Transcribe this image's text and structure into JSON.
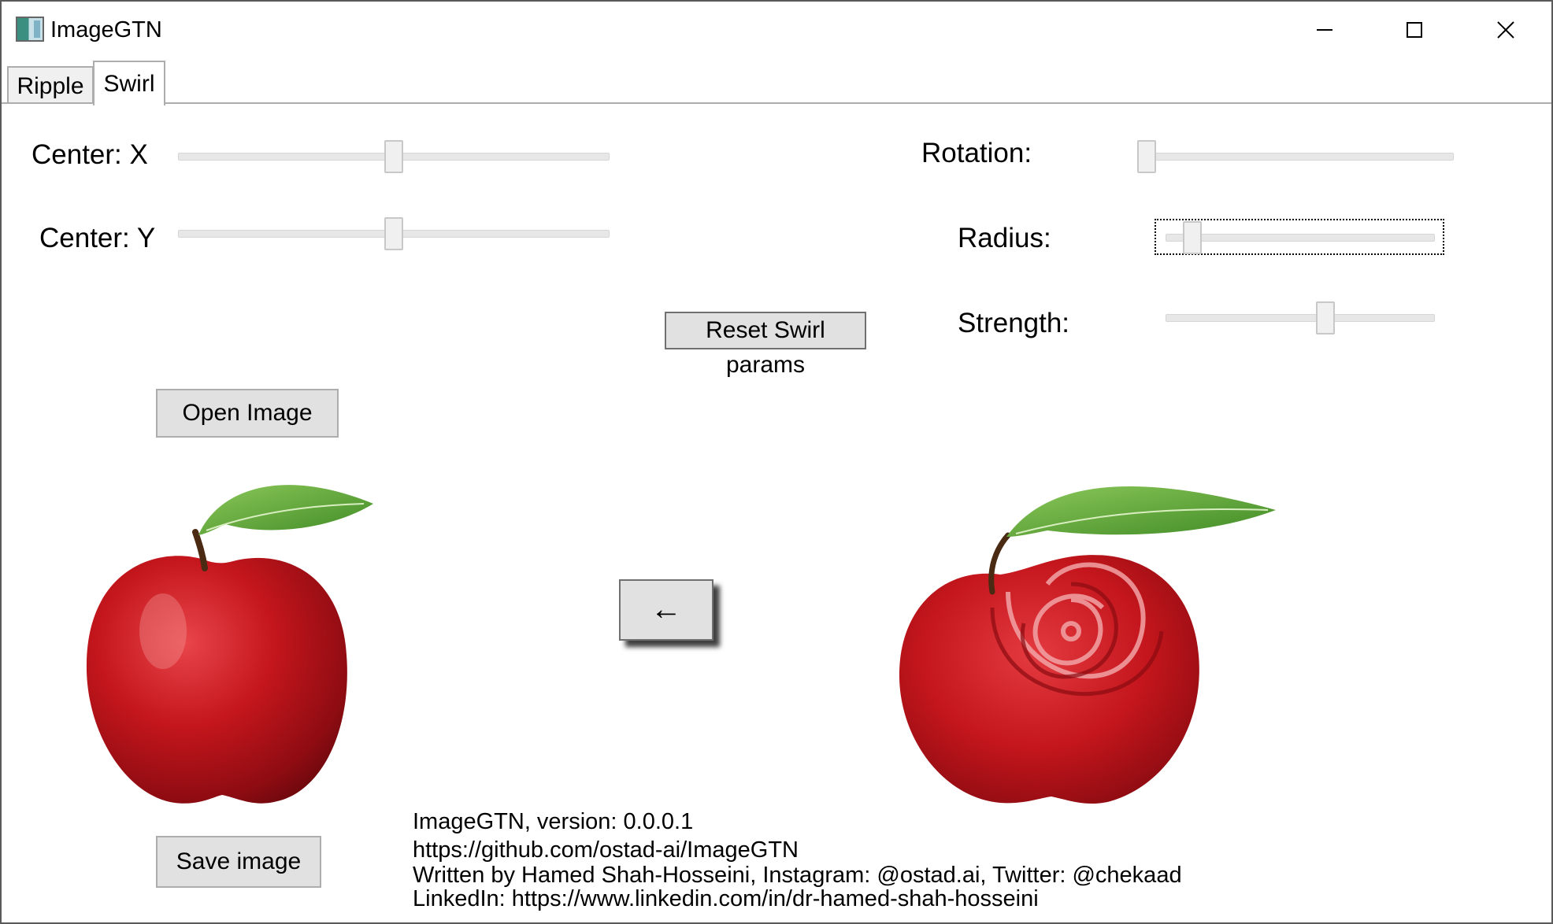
{
  "window": {
    "title": "ImageGTN",
    "icon": "app-icon"
  },
  "controls": {
    "minimize": "minimize-icon",
    "maximize": "maximize-icon",
    "close": "close-icon"
  },
  "tabs": [
    {
      "label": "Ripple",
      "selected": false
    },
    {
      "label": "Swirl",
      "selected": true
    }
  ],
  "params": {
    "center_x": {
      "label": "Center: X",
      "value": 0.5
    },
    "center_y": {
      "label": "Center: Y",
      "value": 0.5
    },
    "rotation": {
      "label": "Rotation:",
      "value": 0.0
    },
    "radius": {
      "label": "Radius:",
      "value": 0.07
    },
    "strength": {
      "label": "Strength:",
      "value": 0.6
    }
  },
  "buttons": {
    "reset": "Reset Swirl params",
    "open": "Open Image",
    "apply": "←",
    "save": "Save image"
  },
  "info": {
    "line1": "ImageGTN, version: 0.0.0.1",
    "line2": "https://github.com/ostad-ai/ImageGTN",
    "line3": "Written by Hamed Shah-Hosseini, Instagram: @ostad.ai, Twitter: @chekaad",
    "line4": "LinkedIn: https://www.linkedin.com/in/dr-hamed-shah-hosseini"
  },
  "colors": {
    "button_face": "#e1e1e1",
    "slider_track": "#e7e7e7",
    "apple_red": "#c4161c",
    "leaf_green": "#5aa032"
  }
}
